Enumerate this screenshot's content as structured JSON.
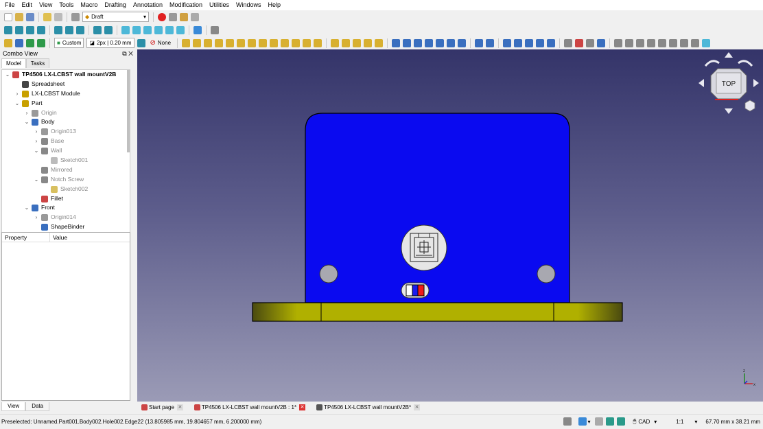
{
  "menu": [
    "File",
    "Edit",
    "View",
    "Tools",
    "Macro",
    "Drafting",
    "Annotation",
    "Modification",
    "Utilities",
    "Windows",
    "Help"
  ],
  "toolbar": {
    "workbench": "Draft"
  },
  "draft_toolbar": {
    "style": "Custom",
    "linewidth": "2px | 0.20 mm",
    "snap": "None"
  },
  "combo": {
    "title": "Combo View",
    "tabs": [
      "Model",
      "Tasks"
    ]
  },
  "tree": [
    {
      "label": "TP4506 LX-LCBST wall mountV2B",
      "bold": true,
      "arrow": "⌄",
      "icon": "doc",
      "color": "#c44"
    },
    {
      "label": "Spreadsheet",
      "icon": "sheet",
      "color": "#444"
    },
    {
      "label": "LX-LCBST Module",
      "arrow": "›",
      "icon": "part",
      "color": "#c8a000"
    },
    {
      "label": "Part",
      "arrow": "⌄",
      "icon": "part",
      "color": "#c8a000"
    },
    {
      "label": "Origin",
      "arrow": "›",
      "icon": "origin",
      "dim": true,
      "color": "#999"
    },
    {
      "label": "Body",
      "arrow": "⌄",
      "icon": "body",
      "color": "#3a6fbf"
    },
    {
      "label": "Origin013",
      "arrow": "›",
      "icon": "origin",
      "dim": true,
      "color": "#999"
    },
    {
      "label": "Base",
      "arrow": "›",
      "icon": "feat",
      "dim": true,
      "color": "#888"
    },
    {
      "label": "Wall",
      "arrow": "⌄",
      "icon": "feat",
      "dim": true,
      "color": "#888"
    },
    {
      "label": "Sketch001",
      "icon": "sketch",
      "dim": true,
      "color": "#bbb"
    },
    {
      "label": "Mirrored",
      "icon": "feat",
      "dim": true,
      "color": "#888"
    },
    {
      "label": "Notch Screw",
      "arrow": "⌄",
      "icon": "feat",
      "dim": true,
      "color": "#888"
    },
    {
      "label": "Sketch002",
      "icon": "sketch",
      "dim": true,
      "color": "#d8c060"
    },
    {
      "label": "Fillet",
      "icon": "fillet",
      "color": "#c44"
    },
    {
      "label": "Front",
      "arrow": "⌄",
      "icon": "body",
      "color": "#3a6fbf"
    },
    {
      "label": "Origin014",
      "arrow": "›",
      "icon": "origin",
      "dim": true,
      "color": "#999"
    },
    {
      "label": "ShapeBinder",
      "icon": "feat",
      "color": "#3a6fbf"
    }
  ],
  "properties": {
    "col1": "Property",
    "col2": "Value"
  },
  "bottom_tabs": [
    "View",
    "Data"
  ],
  "navcube": {
    "face": "TOP"
  },
  "doc_tabs": [
    {
      "label": "Start page",
      "icon": "#c44"
    },
    {
      "label": "TP4506 LX-LCBST wall mountV2B : 1*",
      "icon": "#c44",
      "active": true
    },
    {
      "label": "TP4506 LX-LCBST wall mountV2B*",
      "icon": "#555"
    }
  ],
  "status": {
    "text": "Preselected: Unnamed.Part001.Body002.Hole002.Edge22 (13.805985 mm, 19.804657 mm, 6.200000 mm)",
    "nav_style": "CAD",
    "scale": "1:1",
    "dims": "67.70 mm x 38.21 mm"
  },
  "colors": {
    "plate": "#0a0af0",
    "base": "#b8b800",
    "bg_top": "#343469",
    "bg_bottom": "#9b9bb6"
  }
}
